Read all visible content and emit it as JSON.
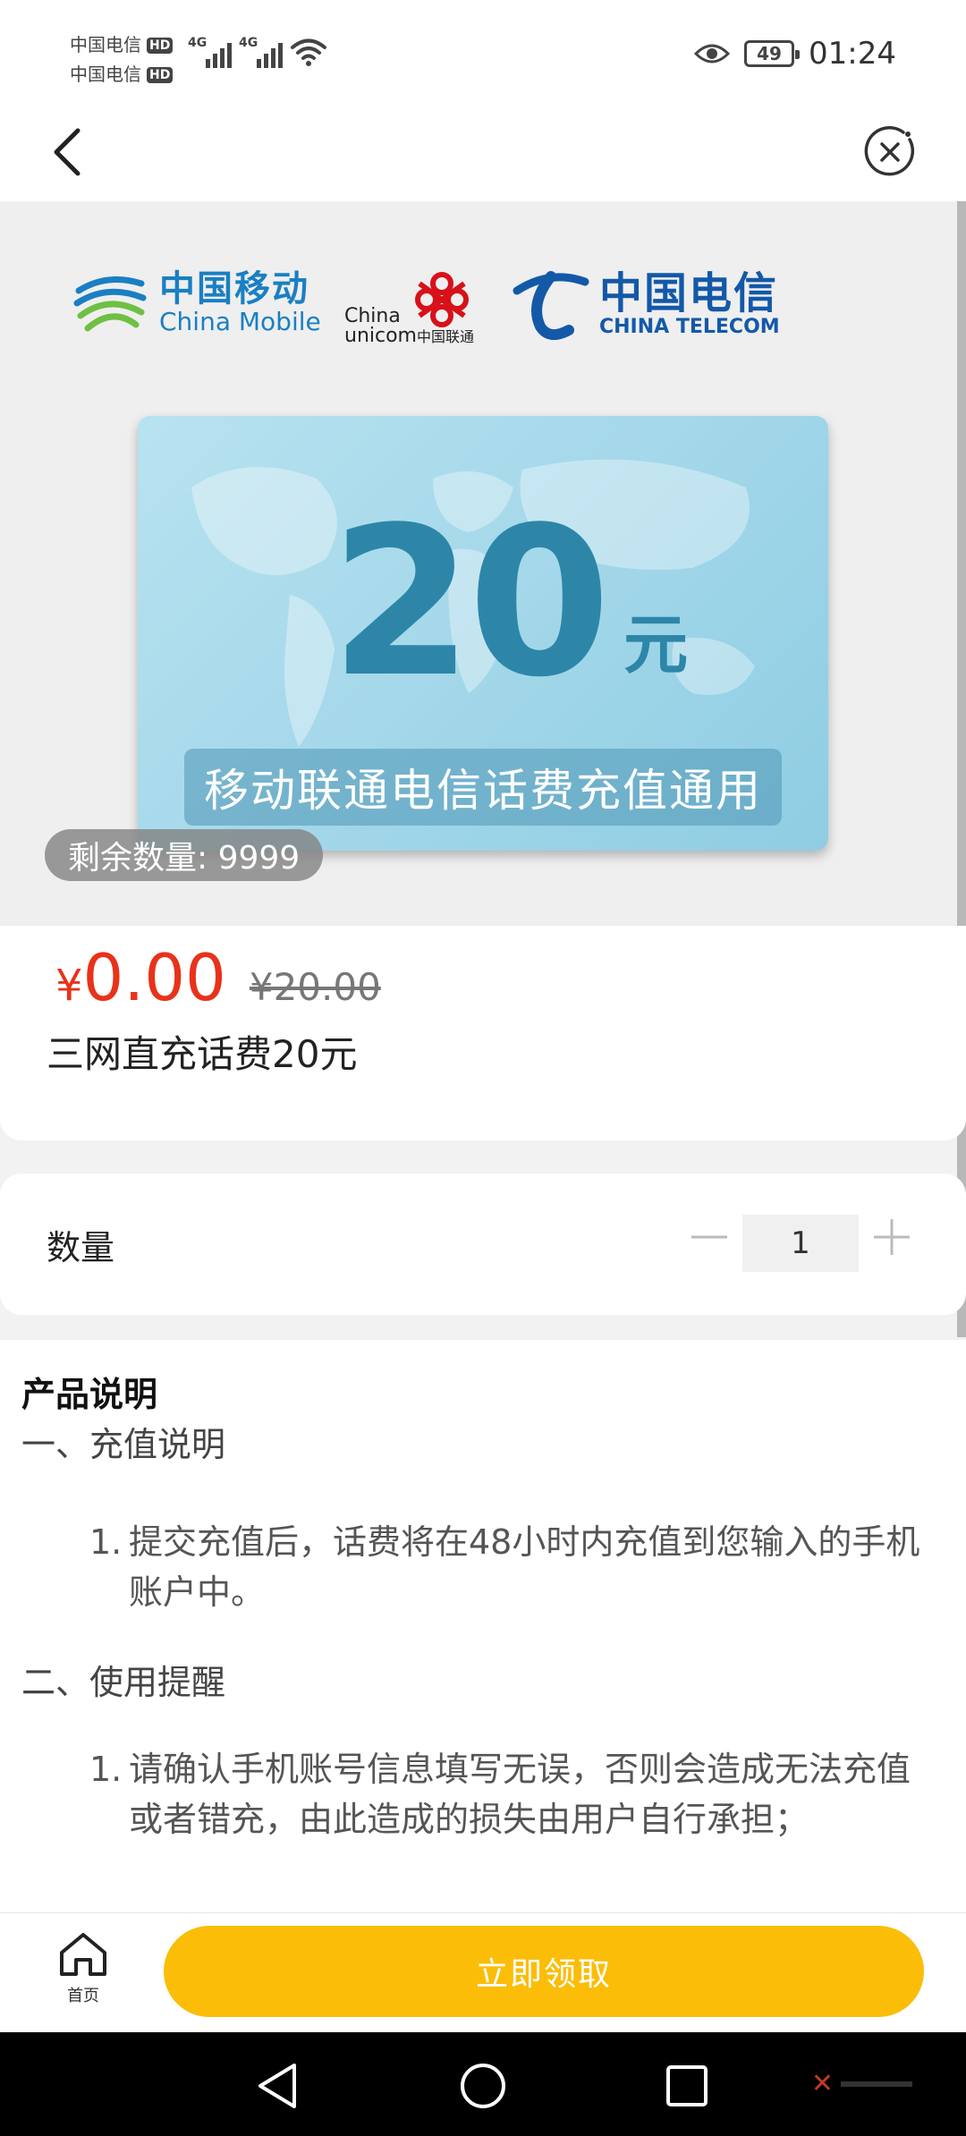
{
  "status_bar": {
    "carriers": [
      {
        "name": "中国电信",
        "badge": "HD"
      },
      {
        "name": "中国电信",
        "badge": "HD"
      }
    ],
    "network_tags": [
      "4G",
      "4G"
    ],
    "battery": "49",
    "time": "01:24"
  },
  "hero": {
    "logos": {
      "china_mobile_cn": "中国移动",
      "china_mobile_en": "China Mobile",
      "china_unicom_en1": "China",
      "china_unicom_en2": "unicom",
      "china_unicom_cn": "中国联通",
      "china_telecom_cn": "中国电信",
      "china_telecom_en": "CHINA TELECOM"
    },
    "card": {
      "amount": "20",
      "unit": "元",
      "caption": "移动联通电信话费充值通用"
    },
    "stock_label": "剩余数量: 9999"
  },
  "price": {
    "currency": "¥",
    "current": "0.00",
    "original": "¥20.00",
    "product_name": "三网直充话费20元"
  },
  "quantity": {
    "label": "数量",
    "value": "1"
  },
  "description": {
    "title": "产品说明",
    "sections": [
      {
        "heading": "一、充值说明",
        "items": [
          {
            "no": "1.",
            "text": "提交充值后，话费将在48小时内充值到您输入的手机账户中。"
          }
        ]
      },
      {
        "heading": "二、使用提醒",
        "items": [
          {
            "no": "1.",
            "text": "请确认手机账号信息填写无误，否则会造成无法充值或者错充，由此造成的损失由用户自行承担；"
          }
        ]
      }
    ]
  },
  "bottom_bar": {
    "home_label": "首页",
    "claim_label": "立即领取"
  },
  "colors": {
    "price_red": "#e8321b",
    "accent_yellow": "#fbbd08",
    "card_blue": "#2d86a8",
    "china_mobile_blue": "#1a7fc3",
    "china_telecom_blue": "#1359a8",
    "unicom_red": "#d7111a"
  }
}
